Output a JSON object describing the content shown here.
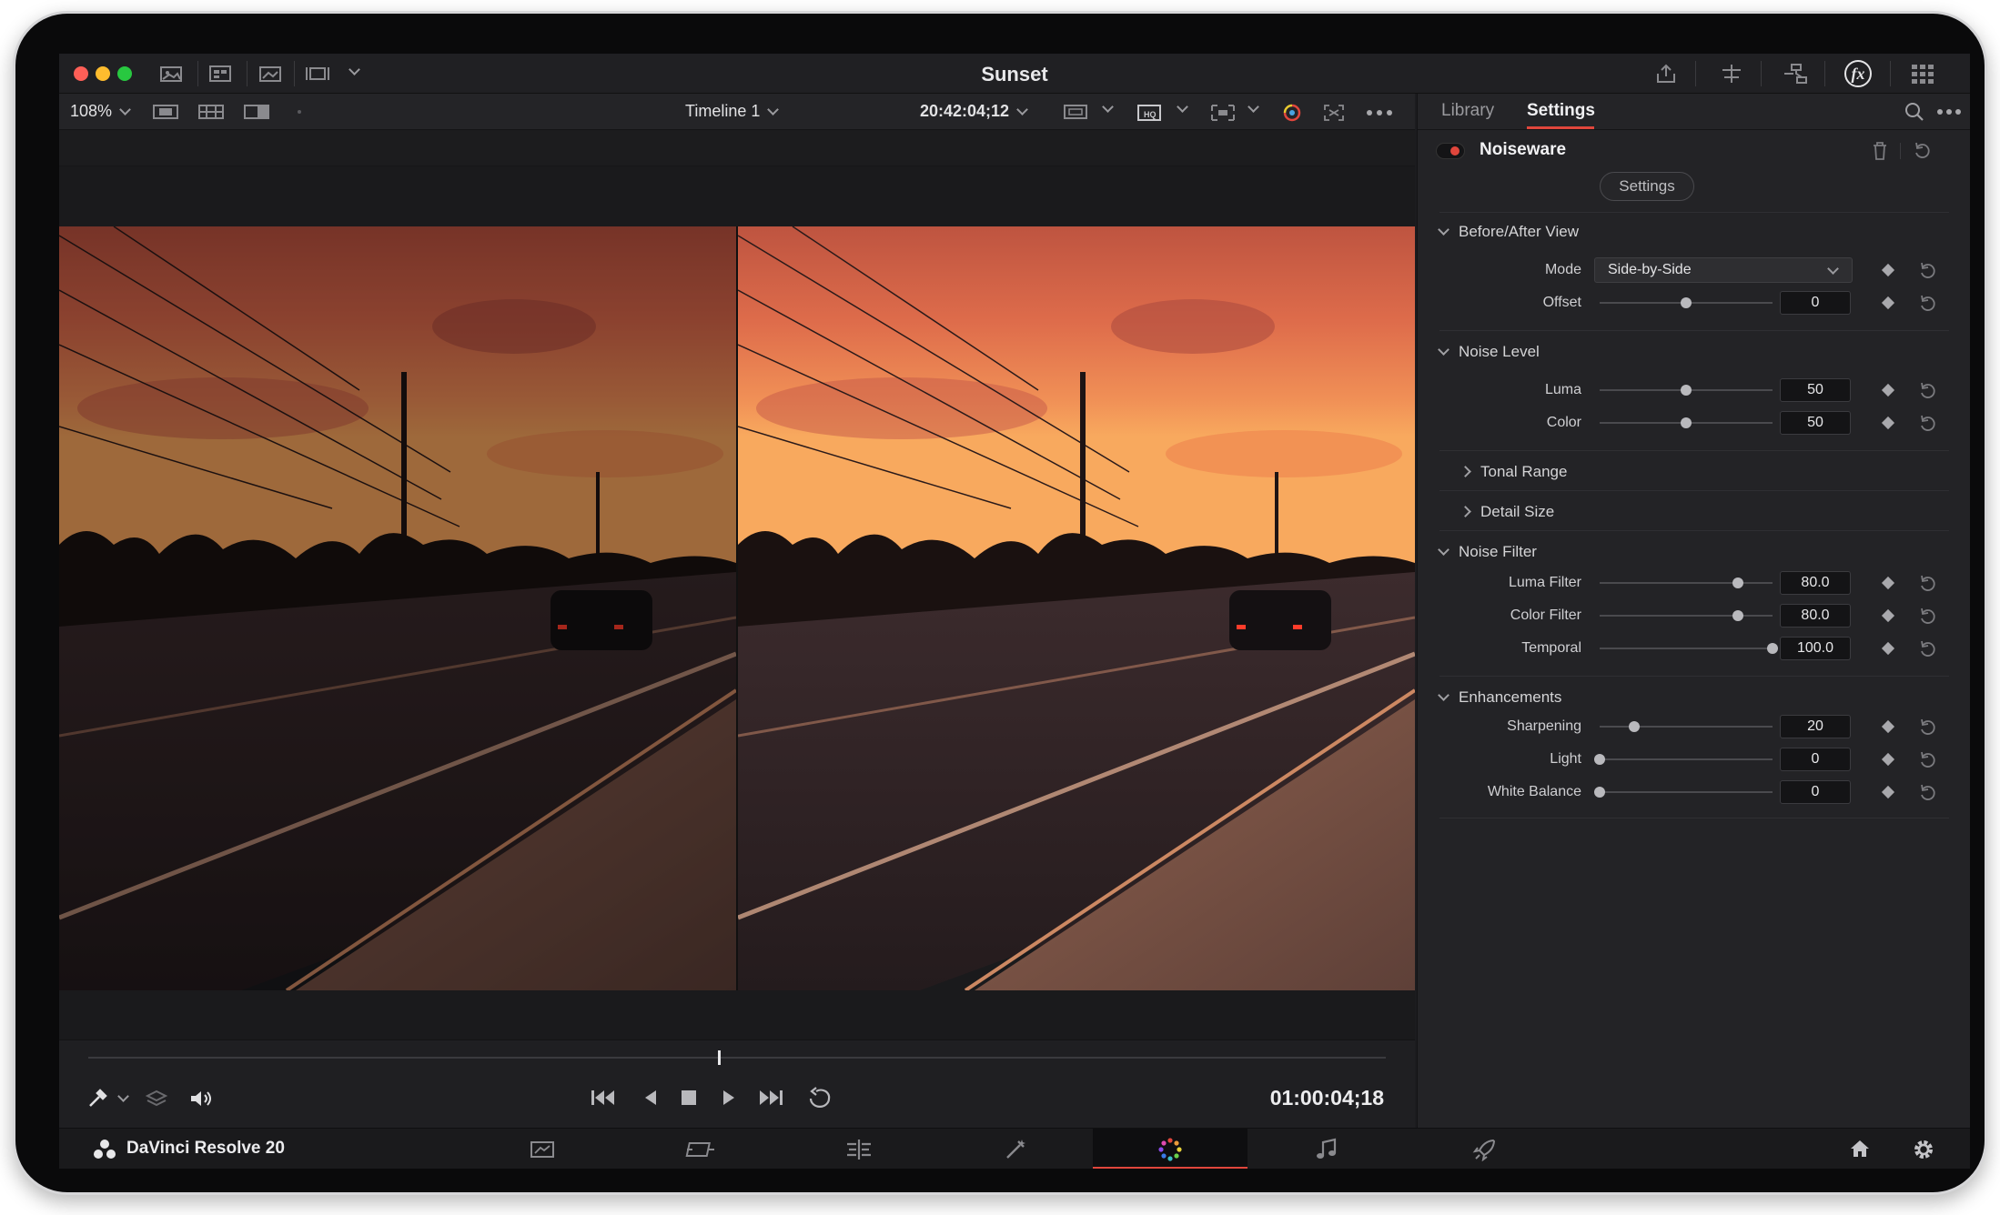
{
  "window": {
    "title": "Sunset"
  },
  "viewer_toolbar": {
    "zoom": "108%",
    "timeline": "Timeline 1",
    "source_timecode": "20:42:04;12"
  },
  "panel": {
    "tabs": [
      {
        "label": "Library",
        "active": false
      },
      {
        "label": "Settings",
        "active": true
      }
    ],
    "effect_name": "Noiseware",
    "settings_button": "Settings",
    "sections": {
      "before_after": {
        "title": "Before/After View",
        "mode_label": "Mode",
        "mode_value": "Side-by-Side",
        "offset_label": "Offset",
        "offset_value": "0",
        "offset_fraction": 0.5
      },
      "noise_level": {
        "title": "Noise Level",
        "luma_label": "Luma",
        "luma_value": "50",
        "luma_fraction": 0.5,
        "color_label": "Color",
        "color_value": "50",
        "color_fraction": 0.5
      },
      "tonal_range": {
        "title": "Tonal Range"
      },
      "detail_size": {
        "title": "Detail Size"
      },
      "noise_filter": {
        "title": "Noise Filter",
        "luma_filter_label": "Luma Filter",
        "luma_filter_value": "80.0",
        "luma_filter_fraction": 0.8,
        "color_filter_label": "Color Filter",
        "color_filter_value": "80.0",
        "color_filter_fraction": 0.8,
        "temporal_label": "Temporal",
        "temporal_value": "100.0",
        "temporal_fraction": 1.0
      },
      "enhancements": {
        "title": "Enhancements",
        "sharpening_label": "Sharpening",
        "sharpening_value": "20",
        "sharpening_fraction": 0.2,
        "light_label": "Light",
        "light_value": "0",
        "light_fraction": 0.0,
        "white_balance_label": "White Balance",
        "white_balance_value": "0",
        "white_balance_fraction": 0.0
      }
    }
  },
  "transport": {
    "timecode": "01:00:04;18",
    "playhead_fraction": 0.485
  },
  "bottom_bar": {
    "app_name": "DaVinci Resolve 20",
    "pages": [
      "media-icon",
      "cut-icon",
      "edit-icon",
      "fusion-icon",
      "color-icon",
      "fairlight-icon",
      "deliver-icon"
    ],
    "active_page": "color-icon"
  },
  "colors": {
    "accent": "#e0463c",
    "traffic_close": "#fe5f57",
    "traffic_minimize": "#febc2e",
    "traffic_zoom": "#28c840"
  }
}
